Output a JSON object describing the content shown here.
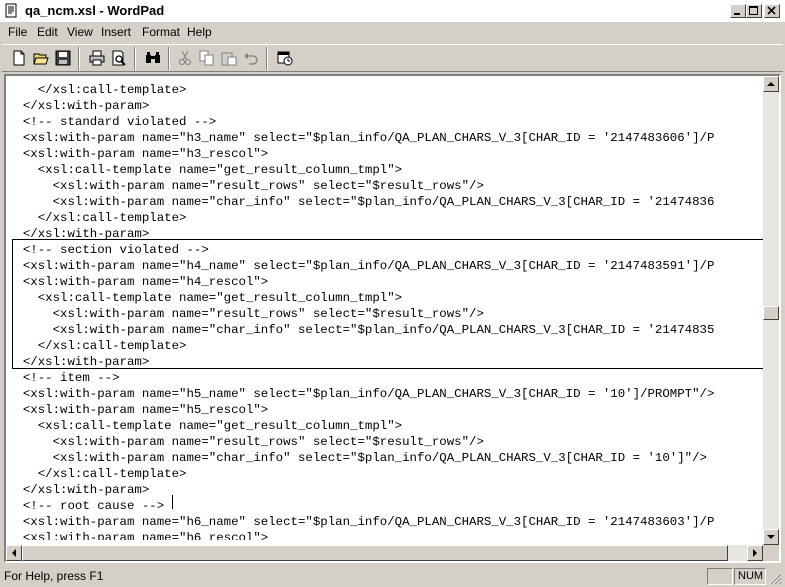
{
  "window": {
    "title": "qa_ncm.xsl - WordPad"
  },
  "title_buttons": {
    "minimize": "_",
    "maximize": "□",
    "close": "✕"
  },
  "menu": {
    "items": [
      "File",
      "Edit",
      "View",
      "Insert",
      "Format",
      "Help"
    ]
  },
  "toolbar": {
    "buttons": [
      "new-icon",
      "open-icon",
      "save-icon",
      "print-icon",
      "print-preview-icon",
      "find-icon",
      "cut-icon",
      "copy-icon",
      "paste-icon",
      "undo-icon",
      "date-time-icon"
    ]
  },
  "editor": {
    "lines": [
      "    </xsl:call-template>",
      "  </xsl:with-param>",
      "  <!-- standard violated -->",
      "  <xsl:with-param name=\"h3_name\" select=\"$plan_info/QA_PLAN_CHARS_V_3[CHAR_ID = '2147483606']/P",
      "  <xsl:with-param name=\"h3_rescol\">",
      "    <xsl:call-template name=\"get_result_column_tmpl\">",
      "      <xsl:with-param name=\"result_rows\" select=\"$result_rows\"/>",
      "      <xsl:with-param name=\"char_info\" select=\"$plan_info/QA_PLAN_CHARS_V_3[CHAR_ID = '21474836",
      "    </xsl:call-template>",
      "  </xsl:with-param>",
      "  <!-- section violated -->",
      "  <xsl:with-param name=\"h4_name\" select=\"$plan_info/QA_PLAN_CHARS_V_3[CHAR_ID = '2147483591']/P",
      "  <xsl:with-param name=\"h4_rescol\">",
      "    <xsl:call-template name=\"get_result_column_tmpl\">",
      "      <xsl:with-param name=\"result_rows\" select=\"$result_rows\"/>",
      "      <xsl:with-param name=\"char_info\" select=\"$plan_info/QA_PLAN_CHARS_V_3[CHAR_ID = '21474835",
      "    </xsl:call-template>",
      "  </xsl:with-param>",
      "  <!-- item -->",
      "  <xsl:with-param name=\"h5_name\" select=\"$plan_info/QA_PLAN_CHARS_V_3[CHAR_ID = '10']/PROMPT\"/>",
      "  <xsl:with-param name=\"h5_rescol\">",
      "    <xsl:call-template name=\"get_result_column_tmpl\">",
      "      <xsl:with-param name=\"result_rows\" select=\"$result_rows\"/>",
      "      <xsl:with-param name=\"char_info\" select=\"$plan_info/QA_PLAN_CHARS_V_3[CHAR_ID = '10']\"/>",
      "    </xsl:call-template>",
      "  </xsl:with-param>",
      "  <!-- root cause -->",
      "  <xsl:with-param name=\"h6_name\" select=\"$plan_info/QA_PLAN_CHARS_V_3[CHAR_ID = '2147483603']/P",
      "  <xsl:with-param name=\"h6_rescol\">"
    ]
  },
  "status": {
    "help_text": "For Help, press F1",
    "num_indicator": "NUM"
  }
}
